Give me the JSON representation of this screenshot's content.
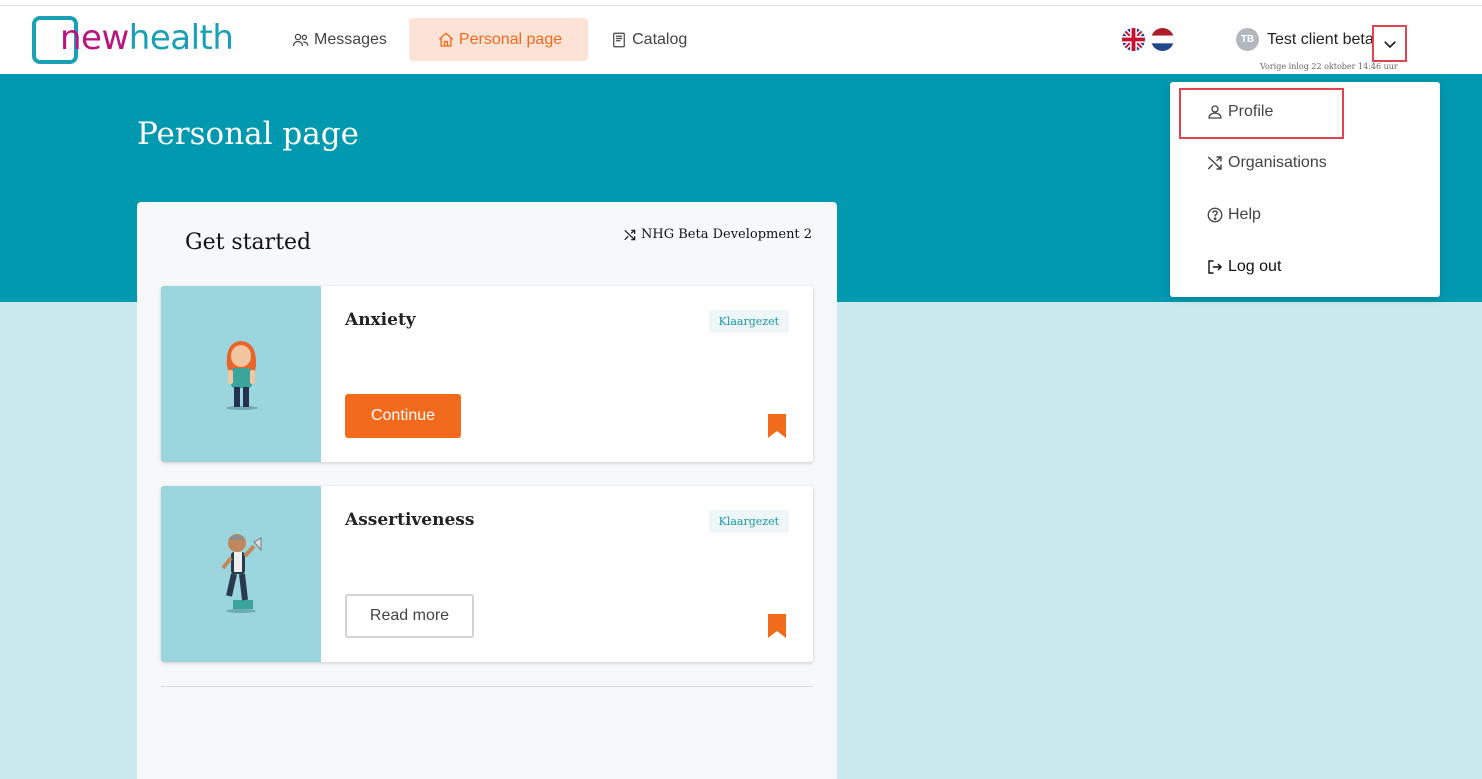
{
  "brand": {
    "logo_part1": "new",
    "logo_part2": "health"
  },
  "nav": {
    "messages": "Messages",
    "personal_page": "Personal page",
    "catalog": "Catalog"
  },
  "user": {
    "initials": "TB",
    "name": "Test client beta",
    "last_login": "Vorige inlog 22 oktober 14:46 uur"
  },
  "page": {
    "title": "Personal page"
  },
  "panel": {
    "title": "Get started",
    "organisation": "NHG Beta Development 2"
  },
  "cards": [
    {
      "title": "Anxiety",
      "status": "Klaargezet",
      "action": "Continue"
    },
    {
      "title": "Assertiveness",
      "status": "Klaargezet",
      "action": "Read more"
    }
  ],
  "dropdown": {
    "profile": "Profile",
    "organisations": "Organisations",
    "help": "Help",
    "logout": "Log out"
  },
  "colors": {
    "teal": "#0099b0",
    "light_teal": "#cbeaed",
    "orange": "#f26a1b",
    "magenta": "#b8167e",
    "highlight": "#e0454f"
  }
}
